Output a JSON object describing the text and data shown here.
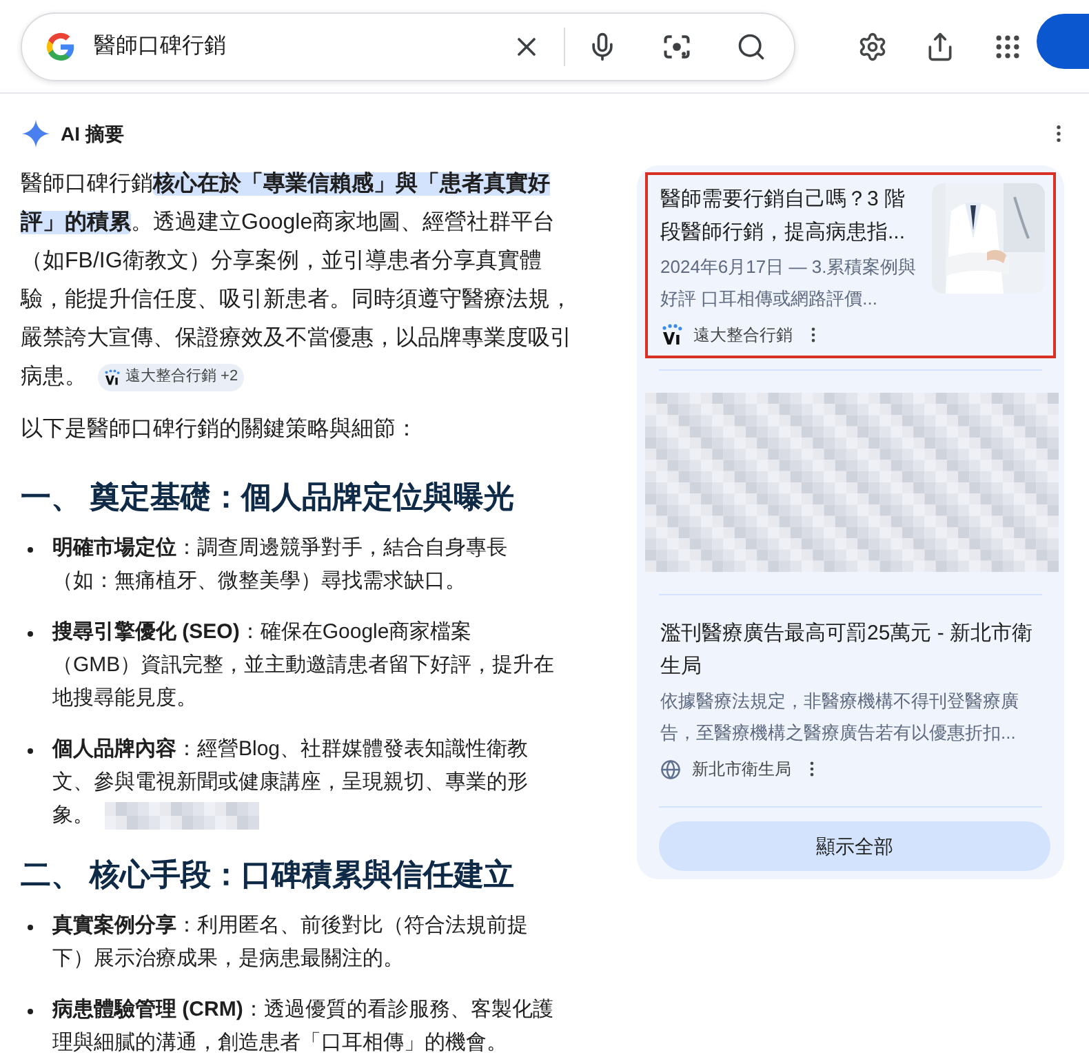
{
  "search": {
    "query": "醫師口碑行銷"
  },
  "ai_overview": {
    "title": "AI 摘要",
    "intro": {
      "segments": [
        {
          "text": "醫師口碑行銷",
          "highlighted": false
        },
        {
          "text": "核心在於「專業信賴感」與「患者真實好評」的積累",
          "highlighted": true
        },
        {
          "text": "。透過建立Google商家地圖、經營社群平台（如FB/IG衛教文）分享案例，並引導患者分享真實體驗，能提升信任度、吸引新患者。同時須遵守醫療法規，嚴禁誇大宣傳、保證療效及不當優惠，以品牌專業度吸引病患。",
          "highlighted": false
        }
      ],
      "source_chip": "遠大整合行銷 +2"
    },
    "lead": "以下是醫師口碑行銷的關鍵策略與細節：",
    "sections": [
      {
        "heading": "一、 奠定基礎：個人品牌定位與曝光",
        "bullets": [
          {
            "text": "**明確市場定位**：調查周邊競爭對手，結合自身專長（如：無痛植牙、微整美學）尋找需求缺口。",
            "redacted_chip": false
          },
          {
            "text": "**搜尋引擎優化 (SEO)**：確保在Google商家檔案（GMB）資訊完整，並主動邀請患者留下好評，提升在地搜尋能見度。",
            "redacted_chip": false
          },
          {
            "text": "**個人品牌內容**：經營Blog、社群媒體發表知識性衛教文、參與電視新聞或健康講座，呈現親切、專業的形象。",
            "redacted_chip": true
          }
        ]
      },
      {
        "heading": "二、 核心手段：口碑積累與信任建立",
        "bullets": [
          {
            "text": "**真實案例分享**：利用匿名、前後對比（符合法規前提下）展示治療成果，是病患最關注的。",
            "redacted_chip": false
          },
          {
            "text": "**病患體驗管理 (CRM)**：透過優質的看診服務、客製化護理與細膩的溝通，創造患者「口耳相傳」的機會。",
            "redacted_chip": false
          }
        ]
      }
    ]
  },
  "sources": {
    "cards": [
      {
        "kind": "article",
        "highlighted": true,
        "title": "醫師需要行銷自己嗎？3 階段醫師行銷，提高病患指...",
        "snippet": "2024年6月17日 — 3.累積案例與好評 口耳相傳或網路評價...",
        "source": "遠大整合行銷",
        "has_image": true
      },
      {
        "kind": "redacted"
      },
      {
        "kind": "article",
        "highlighted": false,
        "title": "濫刊醫療廣告最高可罰25萬元 - 新北市衛生局",
        "snippet": "依據醫療法規定，非醫療機構不得刊登醫療廣告，至醫療機構之醫療廣告若有以優惠折扣...",
        "source": "新北市衛生局",
        "has_image": false
      }
    ],
    "show_all": "顯示全部"
  }
}
